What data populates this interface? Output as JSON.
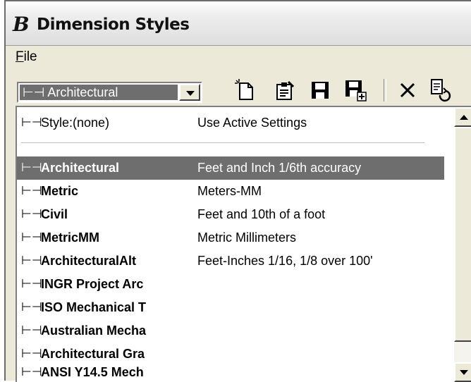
{
  "window": {
    "title": "Dimension Styles",
    "app_icon": "bentley-b-icon"
  },
  "menu": {
    "file_label": "File",
    "file_mnemonic": "F",
    "file_rest": "ile"
  },
  "toolbar": {
    "combo_value": "Architectural",
    "icons": [
      "new-style-icon",
      "properties-icon",
      "save-icon",
      "save-as-icon",
      "delete-icon",
      "reset-icon"
    ]
  },
  "list": {
    "none_row": {
      "glyph": "⊢⊣",
      "name": "Style:(none)",
      "description": "Use Active Settings"
    },
    "rows": [
      {
        "glyph": "⊢⊣",
        "name": "Architectural",
        "description": "Feet and Inch 1/6th accuracy",
        "selected": true
      },
      {
        "glyph": "⊢⊣",
        "name": "Metric",
        "description": "Meters-MM"
      },
      {
        "glyph": "⊢⊣",
        "name": "Civil",
        "description": "Feet and 10th of a foot"
      },
      {
        "glyph": "⊢⊣",
        "name": "MetricMM",
        "description": "Metric Millimeters"
      },
      {
        "glyph": "⊢⊣",
        "name": "ArchitecturalAlt",
        "description": "Feet-Inches 1/16, 1/8 over 100'"
      },
      {
        "glyph": "⊢⊣",
        "name": "INGR Project Arc",
        "description": ""
      },
      {
        "glyph": "⊢⊣",
        "name": "ISO Mechanical T",
        "description": ""
      },
      {
        "glyph": "⊢⊣",
        "name": "Australian Mecha",
        "description": ""
      },
      {
        "glyph": "⊢⊣",
        "name": "Architectural Gra",
        "description": ""
      },
      {
        "glyph": "⊢⊣",
        "name": "ANSI Y14.5 Mech",
        "description": ""
      }
    ]
  },
  "colors": {
    "selection": "#6e6e6e",
    "window_bg": "#ece9d8"
  }
}
